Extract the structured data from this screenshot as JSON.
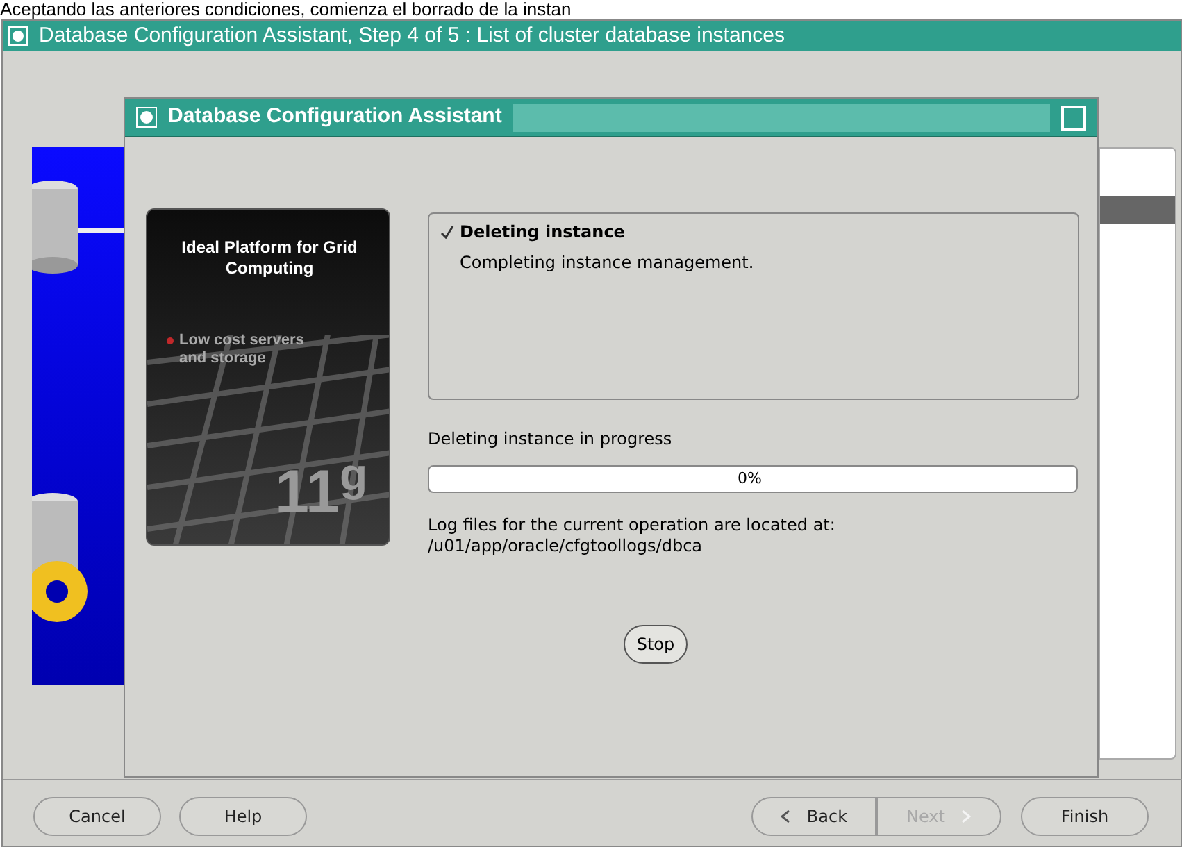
{
  "caption": "Aceptando las anteriores condiciones, comienza el borrado de la instan",
  "window": {
    "title": "Database Configuration Assistant, Step 4 of 5 : List of cluster database instances"
  },
  "dialog": {
    "title": "Database Configuration Assistant",
    "banner": {
      "heading": "Ideal Platform for Grid Computing",
      "bullet": "Low cost servers and storage",
      "version": "11$^{g}$"
    },
    "status": {
      "title": "Deleting instance",
      "done": true,
      "detail": "Completing instance management."
    },
    "progress_label": "Deleting instance in progress",
    "progress": {
      "level": 0,
      "reading": "0%"
    },
    "log_lines": [
      "Log files for the current operation are located at:",
      "/u01/app/oracle/cfgtoollogs/dbca"
    ],
    "stop_button": "Stop"
  },
  "buttons": [
    {
      "label": "Cancel",
      "kind": "plain",
      "disabled": false
    },
    {
      "label": "Help",
      "kind": "plain",
      "disabled": false
    },
    {
      "label": "Back",
      "kind": "back",
      "disabled": false
    },
    {
      "label": "Next",
      "kind": "next",
      "disabled": true
    },
    {
      "label": "Finish",
      "kind": "plain",
      "disabled": false
    }
  ]
}
